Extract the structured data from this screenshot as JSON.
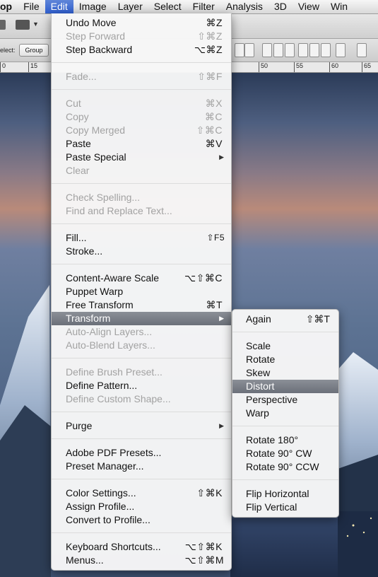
{
  "menubar": {
    "items": [
      "op",
      "File",
      "Edit",
      "Image",
      "Layer",
      "Select",
      "Filter",
      "Analysis",
      "3D",
      "View",
      "Win"
    ]
  },
  "toolbar": {
    "select_label": "elect:",
    "group_value": "Group"
  },
  "ruler": {
    "ticks": [
      "0",
      "15",
      "50",
      "55",
      "60",
      "65"
    ]
  },
  "edit_menu": {
    "undo": {
      "label": "Undo Move",
      "shortcut": "⌘Z"
    },
    "step_forward": {
      "label": "Step Forward",
      "shortcut": "⇧⌘Z"
    },
    "step_backward": {
      "label": "Step Backward",
      "shortcut": "⌥⌘Z"
    },
    "fade": {
      "label": "Fade...",
      "shortcut": "⇧⌘F"
    },
    "cut": {
      "label": "Cut",
      "shortcut": "⌘X"
    },
    "copy": {
      "label": "Copy",
      "shortcut": "⌘C"
    },
    "copy_merged": {
      "label": "Copy Merged",
      "shortcut": "⇧⌘C"
    },
    "paste": {
      "label": "Paste",
      "shortcut": "⌘V"
    },
    "paste_special": {
      "label": "Paste Special"
    },
    "clear": {
      "label": "Clear"
    },
    "check_spelling": {
      "label": "Check Spelling..."
    },
    "find_replace": {
      "label": "Find and Replace Text..."
    },
    "fill": {
      "label": "Fill...",
      "shortcut": "⇧F5"
    },
    "stroke": {
      "label": "Stroke..."
    },
    "content_aware_scale": {
      "label": "Content-Aware Scale",
      "shortcut": "⌥⇧⌘C"
    },
    "puppet_warp": {
      "label": "Puppet Warp"
    },
    "free_transform": {
      "label": "Free Transform",
      "shortcut": "⌘T"
    },
    "transform": {
      "label": "Transform"
    },
    "auto_align": {
      "label": "Auto-Align Layers..."
    },
    "auto_blend": {
      "label": "Auto-Blend Layers..."
    },
    "define_brush": {
      "label": "Define Brush Preset..."
    },
    "define_pattern": {
      "label": "Define Pattern..."
    },
    "define_shape": {
      "label": "Define Custom Shape..."
    },
    "purge": {
      "label": "Purge"
    },
    "pdf_presets": {
      "label": "Adobe PDF Presets..."
    },
    "preset_manager": {
      "label": "Preset Manager..."
    },
    "color_settings": {
      "label": "Color Settings...",
      "shortcut": "⇧⌘K"
    },
    "assign_profile": {
      "label": "Assign Profile..."
    },
    "convert_profile": {
      "label": "Convert to Profile..."
    },
    "keyboard_shortcuts": {
      "label": "Keyboard Shortcuts...",
      "shortcut": "⌥⇧⌘K"
    },
    "menus": {
      "label": "Menus...",
      "shortcut": "⌥⇧⌘M"
    }
  },
  "transform_menu": {
    "again": {
      "label": "Again",
      "shortcut": "⇧⌘T"
    },
    "scale": "Scale",
    "rotate": "Rotate",
    "skew": "Skew",
    "distort": "Distort",
    "perspective": "Perspective",
    "warp": "Warp",
    "rotate180": "Rotate 180°",
    "rotate90cw": "Rotate 90° CW",
    "rotate90ccw": "Rotate 90° CCW",
    "flip_h": "Flip Horizontal",
    "flip_v": "Flip Vertical"
  },
  "colors": {
    "highlight": "#7a7f88",
    "menubar_active": "#3f6ad3"
  }
}
